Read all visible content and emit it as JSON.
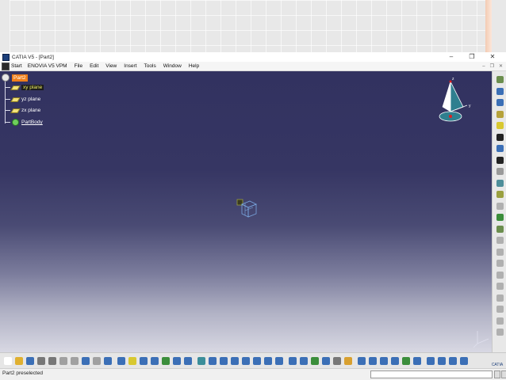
{
  "window": {
    "title": "CATIA V5 - [Part2]",
    "controls": [
      "–",
      "❐",
      "✕"
    ]
  },
  "menubar": {
    "items": [
      "Start",
      "ENOVIA V5 VPM",
      "File",
      "Edit",
      "View",
      "Insert",
      "Tools",
      "Window",
      "Help"
    ],
    "mdi_controls": [
      "–",
      "❐",
      "✕"
    ]
  },
  "tree": {
    "root": "Part2",
    "nodes": [
      {
        "label": "xy plane",
        "icon": "plane-icon",
        "selected": true
      },
      {
        "label": "yz plane",
        "icon": "plane-icon",
        "selected": false
      },
      {
        "label": "zx plane",
        "icon": "plane-icon",
        "selected": false
      },
      {
        "label": "PartBody",
        "icon": "partbody-icon",
        "selected": false
      }
    ]
  },
  "compass": {
    "axis_labels": [
      "z",
      "y"
    ]
  },
  "statusbar": {
    "message": "Part2 preselected",
    "command_input": ""
  },
  "logo": "CATIA",
  "right_toolbar": {
    "icons": [
      "view-icon",
      "sketch-icon",
      "sketch-analysis-icon",
      "select-arrow-icon",
      "sketcher-icon",
      "pad-icon",
      "pocket-icon",
      "shaft-icon",
      "groove-icon",
      "hole-icon",
      "rib-icon",
      "slot-icon",
      "fillet-icon",
      "chamfer-icon",
      "draft-icon",
      "shell-icon",
      "thickness-icon",
      "thread-icon",
      "mirror-icon",
      "pattern-icon",
      "scale-icon",
      "split-icon",
      "thick-surface-icon"
    ],
    "colors": [
      "#6b8e4e",
      "#3b6fb6",
      "#3b6fb6",
      "#b6a23b",
      "#d8c830",
      "#222222",
      "#3b6fb6",
      "#222222",
      "#9a9a9a",
      "#4e8e9a",
      "#9aa040",
      "#b0b0b0",
      "#3b8e3b",
      "#6b8e4e",
      "#b0b0b0",
      "#b0b0b0",
      "#b0b0b0",
      "#b0b0b0",
      "#b0b0b0",
      "#b0b0b0",
      "#b0b0b0",
      "#b0b0b0",
      "#b0b0b0"
    ]
  },
  "bottom_toolbar": {
    "icons": [
      "new-icon",
      "open-icon",
      "save-icon",
      "print-icon",
      "cut-icon",
      "copy-icon",
      "paste-icon",
      "undo-icon",
      "redo-icon",
      "whats-this-icon",
      "formula-icon",
      "comment-icon",
      "measure-icon",
      "catalog-icon",
      "chart-icon",
      "macro-icon",
      "insert-icon",
      "fly-icon",
      "fit-all-icon",
      "pan-icon",
      "rotate-icon",
      "zoom-in-icon",
      "zoom-out-icon",
      "normal-view-icon",
      "iso-view-icon",
      "shading-icon",
      "hide-show-icon",
      "swap-icon",
      "render-icon",
      "tools-icon",
      "publish-icon",
      "gear-icon",
      "constraint-icon",
      "analysis-icon",
      "web-icon",
      "color-icon",
      "layer-icon",
      "axis-icon",
      "grid-icon",
      "update-icon",
      "filter-icon"
    ],
    "colors": [
      "#ffffff",
      "#e0b030",
      "#3b6fb6",
      "#777777",
      "#777777",
      "#a0a0a0",
      "#a0a0a0",
      "#3b6fb6",
      "#a0a0a0",
      "#3b6fb6",
      "#3b6fb6",
      "#d8c830",
      "#3b6fb6",
      "#3b6fb6",
      "#3b8e3b",
      "#3b6fb6",
      "#3b6fb6",
      "#3b8e9a",
      "#3b6fb6",
      "#3b6fb6",
      "#3b6fb6",
      "#3b6fb6",
      "#3b6fb6",
      "#3b6fb6",
      "#3b6fb6",
      "#3b6fb6",
      "#3b6fb6",
      "#3b8e3b",
      "#3b6fb6",
      "#777777",
      "#d8a030",
      "#3b6fb6",
      "#3b6fb6",
      "#3b6fb6",
      "#3b6fb6",
      "#3b8e3b",
      "#3b6fb6",
      "#3b6fb6",
      "#3b6fb6",
      "#3b6fb6",
      "#3b6fb6"
    ]
  }
}
